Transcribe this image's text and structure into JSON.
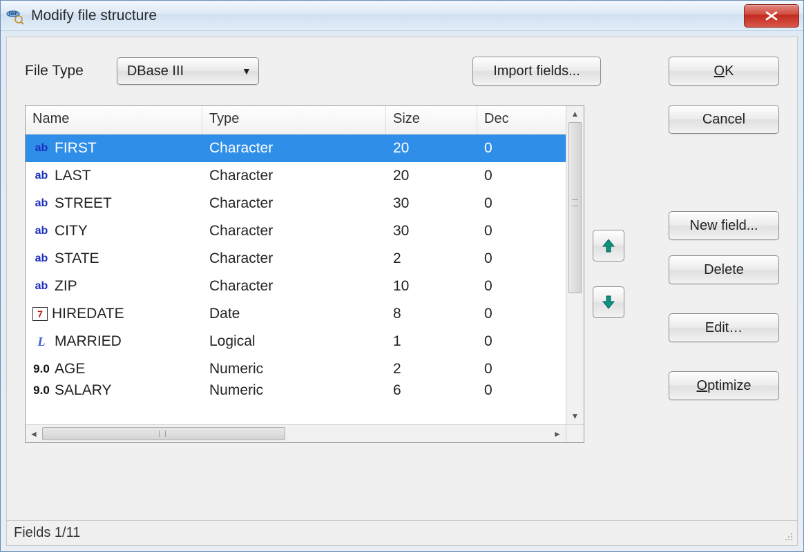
{
  "window": {
    "title": "Modify file structure"
  },
  "labels": {
    "fileType": "File Type"
  },
  "dropdown": {
    "value": "DBase III"
  },
  "buttons": {
    "importFields": "Import fields...",
    "ok": "OK",
    "cancel": "Cancel",
    "newField": "New field...",
    "delete": "Delete",
    "edit": "Edit…",
    "optimize": "Optimize"
  },
  "columns": {
    "name": "Name",
    "type": "Type",
    "size": "Size",
    "dec": "Dec"
  },
  "fields": [
    {
      "icon": "ab",
      "name": "FIRST",
      "type": "Character",
      "size": "20",
      "dec": "0",
      "selected": true
    },
    {
      "icon": "ab",
      "name": "LAST",
      "type": "Character",
      "size": "20",
      "dec": "0",
      "selected": false
    },
    {
      "icon": "ab",
      "name": "STREET",
      "type": "Character",
      "size": "30",
      "dec": "0",
      "selected": false
    },
    {
      "icon": "ab",
      "name": "CITY",
      "type": "Character",
      "size": "30",
      "dec": "0",
      "selected": false
    },
    {
      "icon": "ab",
      "name": "STATE",
      "type": "Character",
      "size": "2",
      "dec": "0",
      "selected": false
    },
    {
      "icon": "ab",
      "name": "ZIP",
      "type": "Character",
      "size": "10",
      "dec": "0",
      "selected": false
    },
    {
      "icon": "date",
      "name": "HIREDATE",
      "type": "Date",
      "size": "8",
      "dec": "0",
      "selected": false
    },
    {
      "icon": "log",
      "name": "MARRIED",
      "type": "Logical",
      "size": "1",
      "dec": "0",
      "selected": false
    },
    {
      "icon": "num",
      "name": "AGE",
      "type": "Numeric",
      "size": "2",
      "dec": "0",
      "selected": false
    },
    {
      "icon": "num",
      "name": "SALARY",
      "type": "Numeric",
      "size": "6",
      "dec": "0",
      "selected": false
    }
  ],
  "iconGlyphs": {
    "ab": "ab",
    "date": "7",
    "log": "L",
    "num": "9.0"
  },
  "status": "Fields 1/11"
}
